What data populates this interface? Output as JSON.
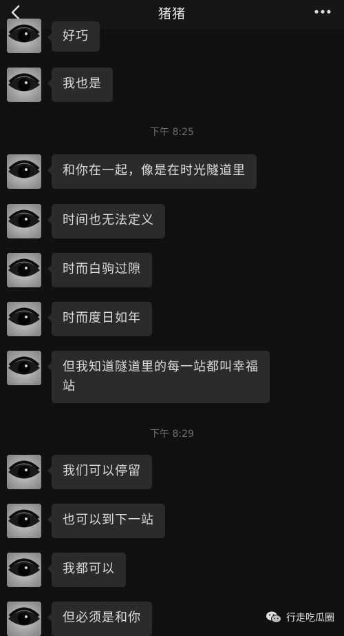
{
  "header": {
    "title": "猪猪",
    "back_icon": "chevron-left-icon",
    "more_icon": "more-dots-icon"
  },
  "timestamps": [
    "下午 8:25",
    "下午 8:29"
  ],
  "messages": [
    {
      "text": "好巧"
    },
    {
      "text": "我也是"
    },
    {
      "text": "和你在一起，像是在时光隧道里"
    },
    {
      "text": "时间也无法定义"
    },
    {
      "text": "时而白驹过隙"
    },
    {
      "text": "时而度日如年"
    },
    {
      "line1": "但我知道隧道里的每一站都叫幸福",
      "line2": "站"
    },
    {
      "text": "我们可以停留"
    },
    {
      "text": "也可以到下一站"
    },
    {
      "text": "我都可以"
    },
    {
      "text": "但必须是和你"
    }
  ],
  "watermark": {
    "icon": "wechat-icon",
    "text": "行走吃瓜圈"
  },
  "colors": {
    "background": "#111111",
    "bubble": "#2b2b2b",
    "text": "#dcdcdc"
  }
}
